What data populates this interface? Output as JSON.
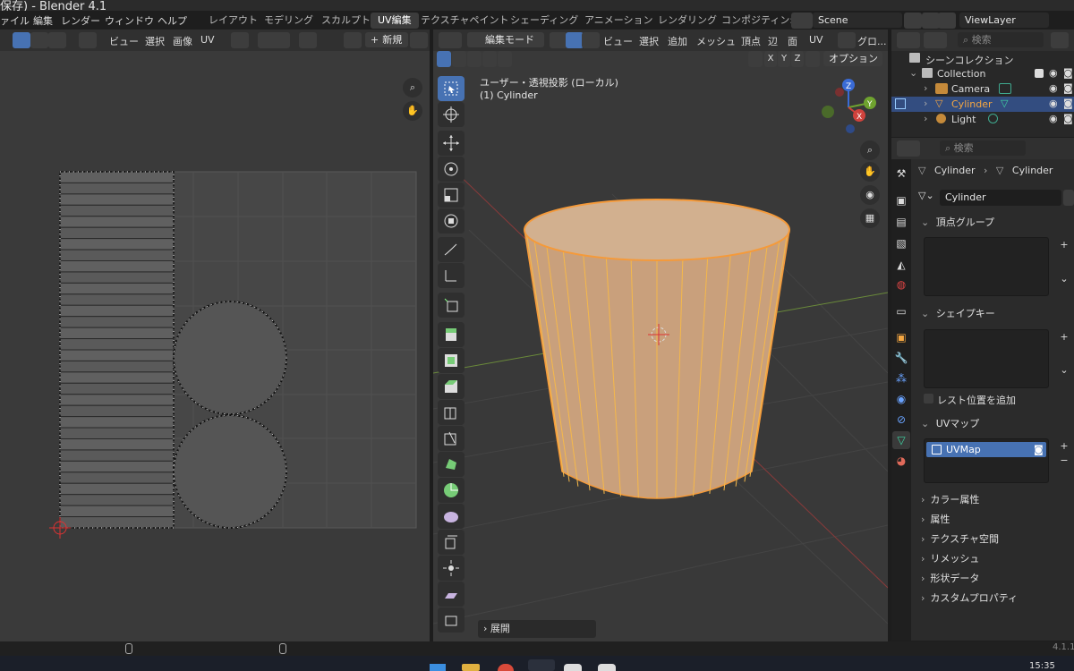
{
  "window": {
    "title": "保存) - Blender 4.1"
  },
  "menu": [
    "ァイル",
    "編集",
    "レンダー",
    "ウィンドウ",
    "ヘルプ"
  ],
  "workspaces": [
    "レイアウト",
    "モデリング",
    "スカルプト",
    "UV編集",
    "テクスチャペイント",
    "シェーディング",
    "アニメーション",
    "レンダリング",
    "コンポジティン:"
  ],
  "active_workspace": "UV編集",
  "scene": {
    "name": "Scene"
  },
  "view_layer": {
    "name": "ViewLayer"
  },
  "uv_header": {
    "view": "ビュー",
    "select": "選択",
    "image": "画像",
    "uv": "UV",
    "new_button": "新規"
  },
  "vp_header": {
    "mode": "編集モード",
    "view": "ビュー",
    "select": "選択",
    "add": "追加",
    "mesh": "メッシュ",
    "vertex": "頂点",
    "edge": "辺",
    "face": "面",
    "uv": "UV",
    "transform_orientation": "グロ..."
  },
  "vp_subheader": {
    "x": "X",
    "y": "Y",
    "z": "Z",
    "options": "オプション"
  },
  "viewport": {
    "view_name": "ユーザー・透視投影 (ローカル)",
    "object_name": "(1) Cylinder",
    "operator_panel": "展開"
  },
  "gizmo": {
    "x": "X",
    "y": "Y",
    "z": "Z"
  },
  "outliner": {
    "search_placeholder": "検索",
    "scene_collection": "シーンコレクション",
    "collection": "Collection",
    "items": [
      {
        "name": "Camera",
        "selected": false
      },
      {
        "name": "Cylinder",
        "selected": true
      },
      {
        "name": "Light",
        "selected": false
      }
    ]
  },
  "properties": {
    "search_placeholder": "検索",
    "breadcrumb": [
      "Cylinder",
      "Cylinder"
    ],
    "data_name": "Cylinder",
    "panels": {
      "vertex_groups": "頂点グループ",
      "shape_keys": "シェイプキー",
      "relative_label": "レスト位置を追加",
      "uv_maps": "UVマップ",
      "uv_map_item": "UVMap",
      "color_attributes": "カラー属性",
      "attributes": "属性",
      "texture_space": "テクスチャ空間",
      "remesh": "リメッシュ",
      "geometry_data": "形状データ",
      "custom_properties": "カスタムプロパティ"
    }
  },
  "status": {
    "version": "4.1.1"
  },
  "taskbar": {
    "time": "15:35"
  },
  "colors": {
    "accent": "#4772b3",
    "selection": "#f59a3a",
    "mesh_fill": "#c9a07c"
  }
}
